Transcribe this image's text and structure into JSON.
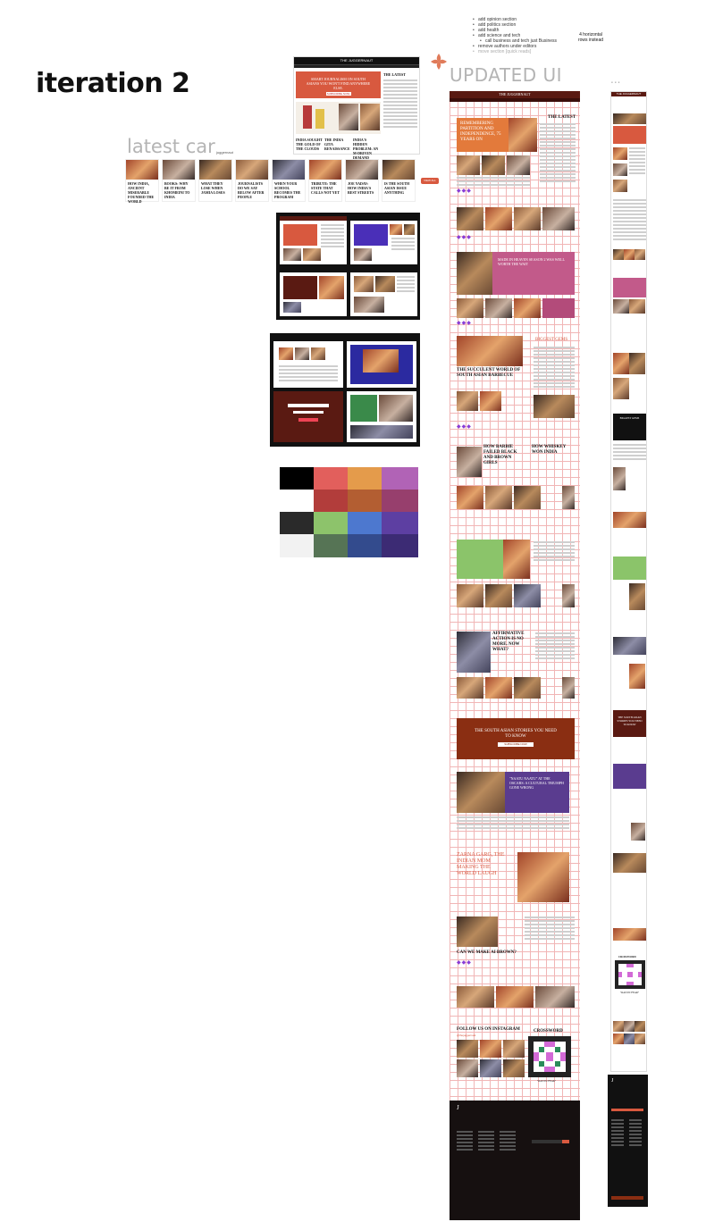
{
  "canvas": {
    "iteration_title": "iteration 2",
    "latest_car_label": "latest car",
    "updated_ui_label": "UPDATED UI",
    "frame_menu_dots": "...",
    "horizontal_note": "4 horizontal rows instead"
  },
  "notes": [
    {
      "text": "add opinion section",
      "level": 0
    },
    {
      "text": "add politics section",
      "level": 0
    },
    {
      "text": "add health",
      "level": 0
    },
    {
      "text": "add science and tech",
      "level": 0
    },
    {
      "text": "call business and tech just Business",
      "level": 1
    },
    {
      "text": "remove authors under editors",
      "level": 0
    },
    {
      "text": "move section [quick reads]",
      "level": 0,
      "muted": true
    }
  ],
  "mockup_top": {
    "brand": "THE JUGGERNAUT",
    "hero_headline": "SMART JOURNALISM ON SOUTH ASIANS YOU WON'T FIND ANYWHERE ELSE.",
    "hero_cta": "SUBSCRIBE NOW",
    "latest_title": "THE LATEST",
    "captions": [
      "INDIA SOUGHT THE GOLD OF THE CLOUDS",
      "THE INDIA GITA RENAISSANCE",
      "INDIA'S HIDDEN PROBLEM: AN M-DRIVEN DEMAND"
    ]
  },
  "carousel": {
    "chip": "juggernaut",
    "button": "VIEW ALL",
    "cards": [
      "HOW INDIA, ANCIENT MISERABLE FOUNDED THE WORLD",
      "BOOKS: WHY BE IT FROM KHOMEINI TO INDIA",
      "WHAT THEY LOSE WHEN JAMIA LOSES",
      "JOURNALISTS DO WE SAY BELOW AFTER PEOPLE",
      "WHEN YOUR SCHOOL BECOMES THE PROGRAM",
      "TRIBUTE: THE STATE THAT CALLS NOT YET",
      "JOE YADAV: HOW INDIA'S BEST STREETS",
      "IS THE SOUTH ASIAN ISSUE ANYTHING"
    ]
  },
  "updated_ui": {
    "brand": "THE JUGGERNAUT",
    "sections": {
      "hero_headline": "REMEMBERING PARTITION AND INDEPENDENCE, 75 YEARS ON",
      "latest": "THE LATEST",
      "made_in_heaven": "MADE IN HEAVEN SEASON 2 WAS WELL WORTH THE WAIT",
      "food_feature": "THE SUCCULENT WORLD OF SOUTH ASIAN BARBECUE",
      "biggest_gems": "BIGGEST GEMS",
      "barbie": "HOW BARBIE FAILED BLACK AND BROWN GIRLS",
      "whiskey": "HOW WHISKEY WON INDIA",
      "affirmative": "AFFIRMATIVE ACTION IS NO MORE. NOW WHAT?",
      "promo": "THE SOUTH ASIAN STORIES YOU NEED TO KNOW",
      "promo_cta": "SUBSCRIBE NOW",
      "naatu": "\"NAATU NAATU\" AT THE OSCARS: A CULTURAL TRIUMPH GONE WRONG",
      "zarna": "ZARNA GARG, THE INDIAN MOM MAKING THE WORLD LAUGH",
      "ai_brown": "CAN WE MAKE AI BROWN?",
      "instagram": "FOLLOW US ON INSTAGRAM",
      "instagram_handle": "@thejuggernaut",
      "crossword": "CROSSWORD",
      "crossword_sub": "\"RAN IN FEAR\"",
      "footer_logo": "J"
    }
  },
  "mobile": {
    "brand": "THE JUGGERNAUT",
    "crossword": "CROSSWORD",
    "crossword_sub": "\"RAN IN FEAR\"",
    "promo": "THE SOUTH ASIAN STORIES YOU NEED TO KNOW",
    "biggest_gems": "BIGGEST GEMS",
    "footer_logo": "J"
  },
  "colors": {
    "accent": "#d8593f",
    "maroon": "#5a1a12",
    "dark": "#111111",
    "purple": "#8a3ed6"
  }
}
